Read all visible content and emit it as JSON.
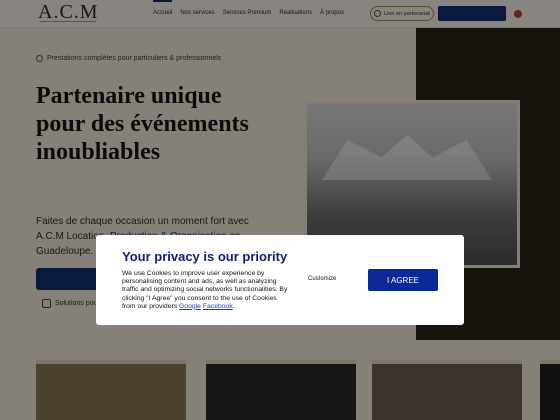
{
  "header": {
    "logo": "A.C.M",
    "nav": [
      "Accueil",
      "Nos services",
      "Services Premium",
      "Réalisations",
      "À propos"
    ],
    "pill_label": "Lien en partenariat",
    "cta_label": "",
    "flag_color": "#c63838"
  },
  "hero": {
    "badge": "Prestations complètes pour particuliers & professionnels",
    "title": "Partenaire unique pour des événements inoubliables",
    "description": "Faites de chaque occasion un moment fort avec A.C.M Location, Production & Organisation en Guadeloupe.",
    "button_label": "",
    "secondary_text": "Solutions pour vos"
  },
  "cookie_modal": {
    "title": "Your privacy is our priority",
    "body": "We use Cookies to improve user experience by personalising content and ads, as well as analyzing traffic and optimizing social networks functionalities. By clicking \"I Agree\" you consent to the use of Cookies from our providers",
    "link_google": "Google",
    "link_separator": " ",
    "link_facebook": "Facebook",
    "trail": ".",
    "customize_label": "Customize",
    "agree_label": "I AGREE"
  },
  "colors": {
    "brand_blue": "#102f72",
    "modal_title": "#0c1f77",
    "page_bg": "#f3ecdd"
  }
}
